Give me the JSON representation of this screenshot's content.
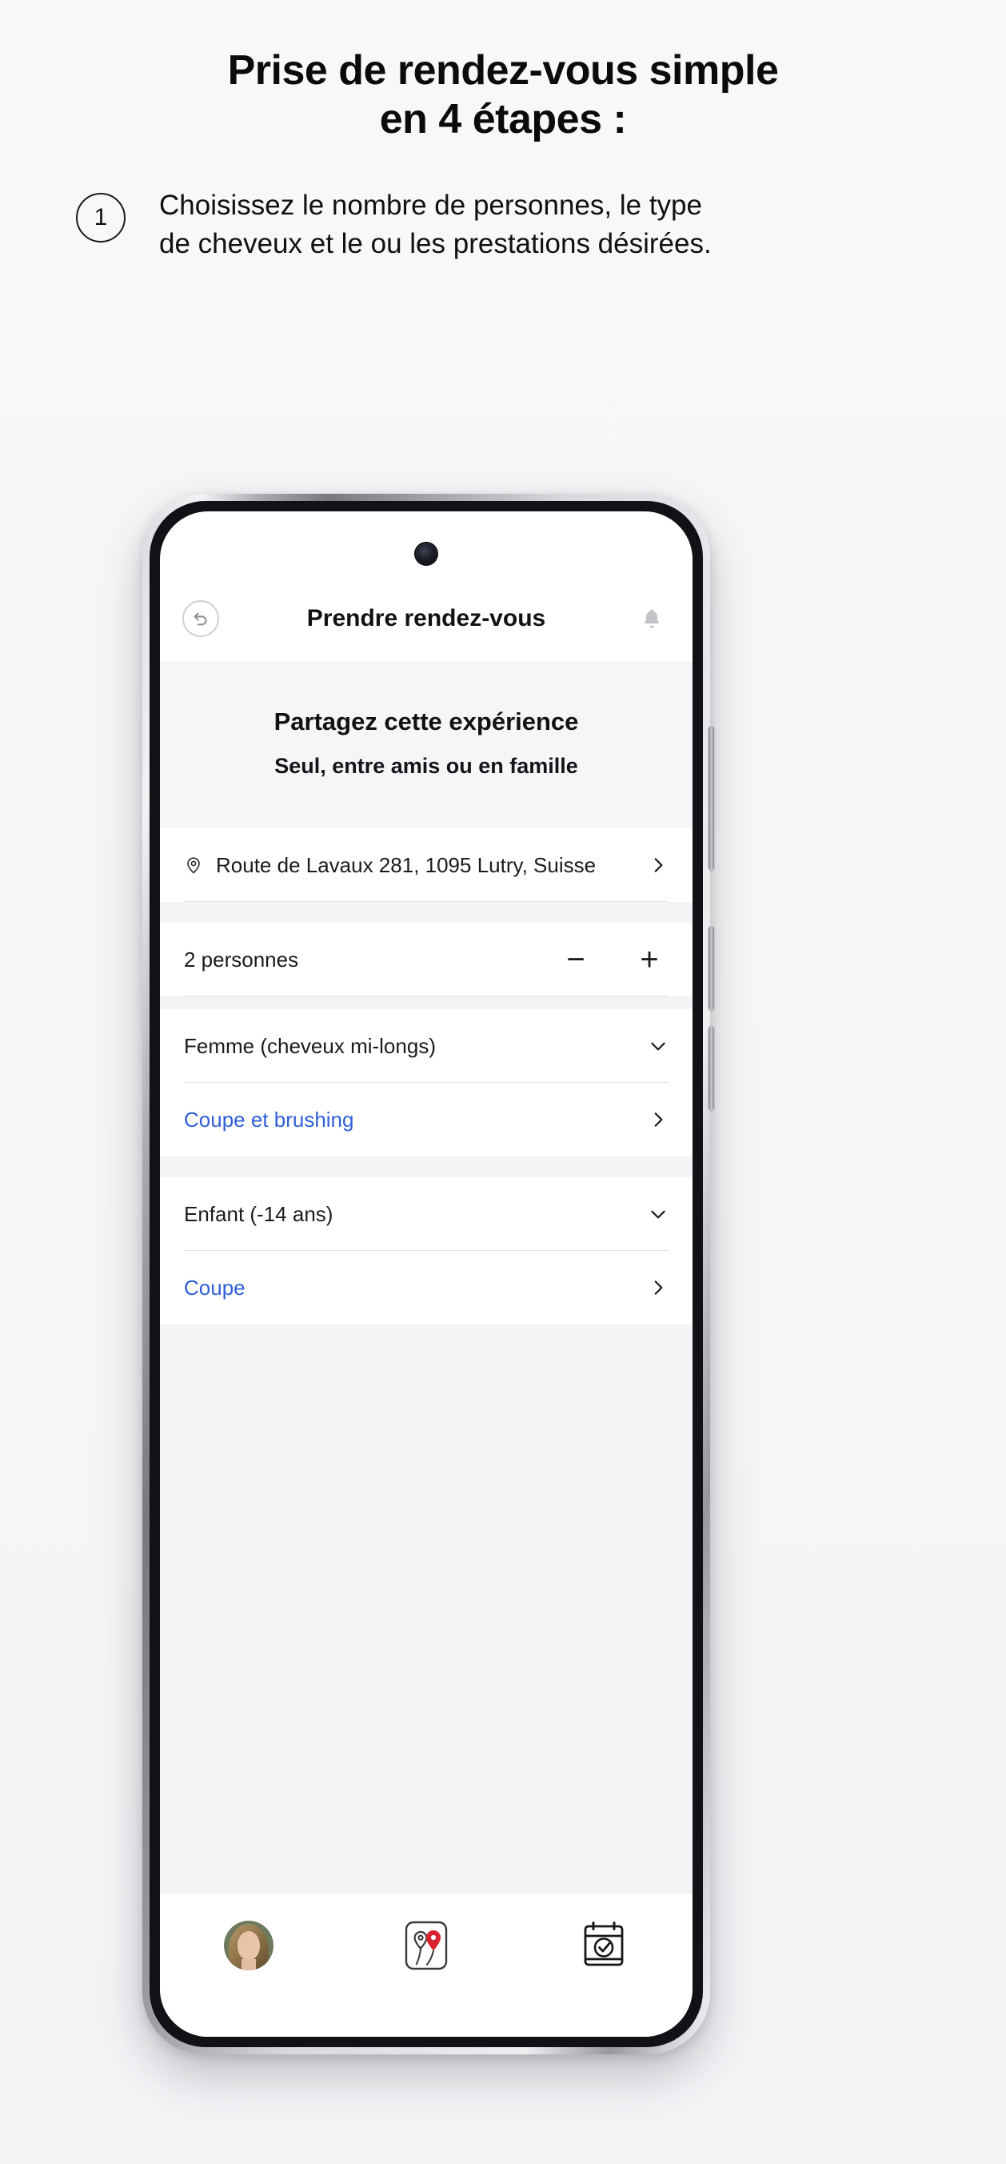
{
  "promo": {
    "headline_line1": "Prise de rendez-vous simple",
    "headline_line2": "en 4 étapes :",
    "step_number": "1",
    "step_text": "Choisissez le nombre de personnes, le type de cheveux et le ou les prestations désirées."
  },
  "colors": {
    "link_blue": "#2f5fd8",
    "page_bg": "#f7f7f9",
    "screen_bg": "#ffffff",
    "section_bg": "#f4f4f6",
    "accent_red": "#d8222f"
  },
  "app": {
    "header": {
      "title": "Prendre rendez-vous",
      "back_icon": "back-arrow-icon",
      "bell_icon": "bell-icon"
    },
    "share": {
      "title": "Partagez cette expérience",
      "subtitle": "Seul, entre amis ou en famille"
    },
    "salon": {
      "address": "Route de Lavaux 281, 1095 Lutry, Suisse",
      "pin_icon": "location-pin-icon",
      "chevron": "chevron-right-icon"
    },
    "people": {
      "label": "2 personnes",
      "count": 2,
      "decrement_label": "−",
      "increment_label": "+"
    },
    "guests": [
      {
        "type_label": "Femme (cheveux mi-longs)",
        "type_chevron": "chevron-down-icon",
        "service_label": "Coupe et brushing",
        "service_chevron": "chevron-right-icon"
      },
      {
        "type_label": "Enfant (-14 ans)",
        "type_chevron": "chevron-down-icon",
        "service_label": "Coupe",
        "service_chevron": "chevron-right-icon"
      }
    ],
    "bottom_nav": [
      {
        "name": "profile-avatar",
        "icon": "user-avatar-icon"
      },
      {
        "name": "salons-map",
        "icon": "map-pins-card-icon"
      },
      {
        "name": "appointments",
        "icon": "calendar-check-icon"
      }
    ]
  }
}
